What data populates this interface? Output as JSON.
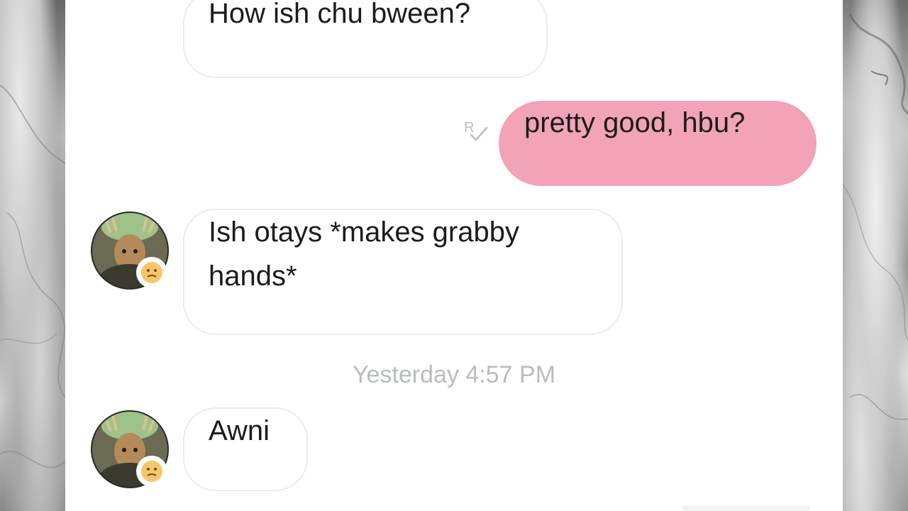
{
  "messages": [
    {
      "direction": "incoming",
      "text": "How ish chu bween?"
    },
    {
      "direction": "outgoing",
      "text": "pretty good, hbu?"
    },
    {
      "direction": "incoming",
      "text": "Ish otays *makes grabby hands*"
    },
    {
      "direction": "incoming",
      "text": "Awni"
    }
  ],
  "timestamp": "Yesterday 4:57 PM",
  "read_receipt_icon": "read-receipt-icon",
  "colors": {
    "outgoing_bubble": "#f2a3b8",
    "incoming_bubble": "#ffffff",
    "timestamp_text": "#b9bcc4",
    "panel_background": "#ffffff"
  }
}
